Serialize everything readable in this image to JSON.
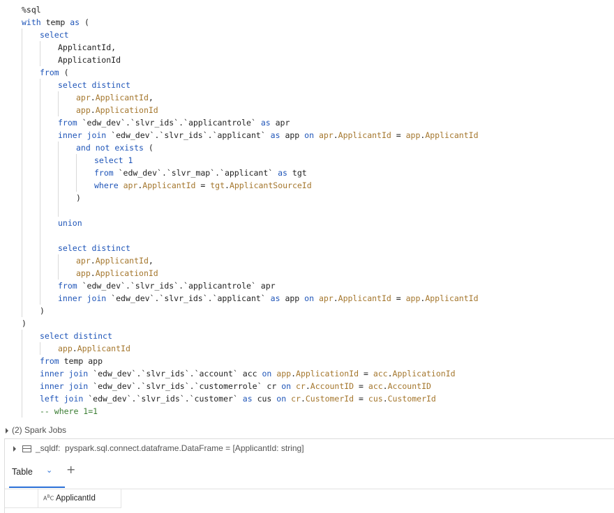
{
  "code_lines": [
    {
      "indent": 0,
      "tokens": [
        {
          "t": "%sql",
          "c": ""
        }
      ]
    },
    {
      "indent": 0,
      "tokens": [
        {
          "t": "with",
          "c": "kw"
        },
        {
          "t": " temp ",
          "c": ""
        },
        {
          "t": "as",
          "c": "kw"
        },
        {
          "t": " (",
          "c": ""
        }
      ]
    },
    {
      "indent": 1,
      "tokens": [
        {
          "t": "select",
          "c": "kw"
        }
      ]
    },
    {
      "indent": 2,
      "tokens": [
        {
          "t": "ApplicantId,",
          "c": ""
        }
      ]
    },
    {
      "indent": 2,
      "tokens": [
        {
          "t": "ApplicationId",
          "c": ""
        }
      ]
    },
    {
      "indent": 1,
      "tokens": [
        {
          "t": "from",
          "c": "kw"
        },
        {
          "t": " (",
          "c": ""
        }
      ]
    },
    {
      "indent": 2,
      "tokens": [
        {
          "t": "select",
          "c": "kw"
        },
        {
          "t": " ",
          "c": ""
        },
        {
          "t": "distinct",
          "c": "kw"
        }
      ]
    },
    {
      "indent": 3,
      "tokens": [
        {
          "t": "apr",
          "c": "al"
        },
        {
          "t": ".",
          "c": ""
        },
        {
          "t": "ApplicantId",
          "c": "al"
        },
        {
          "t": ",",
          "c": ""
        }
      ]
    },
    {
      "indent": 3,
      "tokens": [
        {
          "t": "app",
          "c": "al"
        },
        {
          "t": ".",
          "c": ""
        },
        {
          "t": "ApplicationId",
          "c": "al"
        }
      ]
    },
    {
      "indent": 2,
      "tokens": [
        {
          "t": "from",
          "c": "kw"
        },
        {
          "t": " `edw_dev`.`slvr_ids`.`applicantrole` ",
          "c": ""
        },
        {
          "t": "as",
          "c": "kw"
        },
        {
          "t": " apr",
          "c": ""
        }
      ]
    },
    {
      "indent": 2,
      "tokens": [
        {
          "t": "inner join",
          "c": "kw"
        },
        {
          "t": " `edw_dev`.`slvr_ids`.`applicant` ",
          "c": ""
        },
        {
          "t": "as",
          "c": "kw"
        },
        {
          "t": " app ",
          "c": ""
        },
        {
          "t": "on",
          "c": "kw"
        },
        {
          "t": " ",
          "c": ""
        },
        {
          "t": "apr",
          "c": "al"
        },
        {
          "t": ".",
          "c": ""
        },
        {
          "t": "ApplicantId",
          "c": "al"
        },
        {
          "t": " = ",
          "c": ""
        },
        {
          "t": "app",
          "c": "al"
        },
        {
          "t": ".",
          "c": ""
        },
        {
          "t": "ApplicantId",
          "c": "al"
        }
      ]
    },
    {
      "indent": 3,
      "tokens": [
        {
          "t": "and not exists",
          "c": "kw"
        },
        {
          "t": " (",
          "c": ""
        }
      ]
    },
    {
      "indent": 4,
      "tokens": [
        {
          "t": "select",
          "c": "kw"
        },
        {
          "t": " ",
          "c": ""
        },
        {
          "t": "1",
          "c": "kw"
        }
      ]
    },
    {
      "indent": 4,
      "tokens": [
        {
          "t": "from",
          "c": "kw"
        },
        {
          "t": " `edw_dev`.`slvr_map`.`applicant` ",
          "c": ""
        },
        {
          "t": "as",
          "c": "kw"
        },
        {
          "t": " tgt",
          "c": ""
        }
      ]
    },
    {
      "indent": 4,
      "tokens": [
        {
          "t": "where",
          "c": "kw"
        },
        {
          "t": " ",
          "c": ""
        },
        {
          "t": "apr",
          "c": "al"
        },
        {
          "t": ".",
          "c": ""
        },
        {
          "t": "ApplicantId",
          "c": "al"
        },
        {
          "t": " = ",
          "c": ""
        },
        {
          "t": "tgt",
          "c": "al"
        },
        {
          "t": ".",
          "c": ""
        },
        {
          "t": "ApplicantSourceId",
          "c": "al"
        }
      ]
    },
    {
      "indent": 3,
      "tokens": [
        {
          "t": ")",
          "c": ""
        }
      ]
    },
    {
      "indent": 3,
      "tokens": []
    },
    {
      "indent": 2,
      "tokens": [
        {
          "t": "union",
          "c": "kw"
        }
      ]
    },
    {
      "indent": 2,
      "tokens": []
    },
    {
      "indent": 2,
      "tokens": [
        {
          "t": "select",
          "c": "kw"
        },
        {
          "t": " ",
          "c": ""
        },
        {
          "t": "distinct",
          "c": "kw"
        }
      ]
    },
    {
      "indent": 3,
      "tokens": [
        {
          "t": "apr",
          "c": "al"
        },
        {
          "t": ".",
          "c": ""
        },
        {
          "t": "ApplicantId",
          "c": "al"
        },
        {
          "t": ",",
          "c": ""
        }
      ]
    },
    {
      "indent": 3,
      "tokens": [
        {
          "t": "app",
          "c": "al"
        },
        {
          "t": ".",
          "c": ""
        },
        {
          "t": "ApplicationId",
          "c": "al"
        }
      ]
    },
    {
      "indent": 2,
      "tokens": [
        {
          "t": "from",
          "c": "kw"
        },
        {
          "t": " `edw_dev`.`slvr_ids`.`applicantrole` apr",
          "c": ""
        }
      ]
    },
    {
      "indent": 2,
      "tokens": [
        {
          "t": "inner join",
          "c": "kw"
        },
        {
          "t": " `edw_dev`.`slvr_ids`.`applicant` ",
          "c": ""
        },
        {
          "t": "as",
          "c": "kw"
        },
        {
          "t": " app ",
          "c": ""
        },
        {
          "t": "on",
          "c": "kw"
        },
        {
          "t": " ",
          "c": ""
        },
        {
          "t": "apr",
          "c": "al"
        },
        {
          "t": ".",
          "c": ""
        },
        {
          "t": "ApplicantId",
          "c": "al"
        },
        {
          "t": " = ",
          "c": ""
        },
        {
          "t": "app",
          "c": "al"
        },
        {
          "t": ".",
          "c": ""
        },
        {
          "t": "ApplicantId",
          "c": "al"
        }
      ]
    },
    {
      "indent": 1,
      "tokens": [
        {
          "t": ")",
          "c": ""
        }
      ]
    },
    {
      "indent": 0,
      "tokens": [
        {
          "t": ")",
          "c": ""
        }
      ]
    },
    {
      "indent": 1,
      "tokens": [
        {
          "t": "select",
          "c": "kw"
        },
        {
          "t": " ",
          "c": ""
        },
        {
          "t": "distinct",
          "c": "kw"
        }
      ]
    },
    {
      "indent": 2,
      "tokens": [
        {
          "t": "app",
          "c": "al"
        },
        {
          "t": ".",
          "c": ""
        },
        {
          "t": "ApplicantId",
          "c": "al"
        }
      ]
    },
    {
      "indent": 1,
      "tokens": [
        {
          "t": "from",
          "c": "kw"
        },
        {
          "t": " temp app",
          "c": ""
        }
      ]
    },
    {
      "indent": 1,
      "tokens": [
        {
          "t": "inner join",
          "c": "kw"
        },
        {
          "t": " `edw_dev`.`slvr_ids`.`account` acc ",
          "c": ""
        },
        {
          "t": "on",
          "c": "kw"
        },
        {
          "t": " ",
          "c": ""
        },
        {
          "t": "app",
          "c": "al"
        },
        {
          "t": ".",
          "c": ""
        },
        {
          "t": "ApplicationId",
          "c": "al"
        },
        {
          "t": " = ",
          "c": ""
        },
        {
          "t": "acc",
          "c": "al"
        },
        {
          "t": ".",
          "c": ""
        },
        {
          "t": "ApplicationId",
          "c": "al"
        }
      ]
    },
    {
      "indent": 1,
      "tokens": [
        {
          "t": "inner join",
          "c": "kw"
        },
        {
          "t": " `edw_dev`.`slvr_ids`.`customerrole` cr ",
          "c": ""
        },
        {
          "t": "on",
          "c": "kw"
        },
        {
          "t": " ",
          "c": ""
        },
        {
          "t": "cr",
          "c": "al"
        },
        {
          "t": ".",
          "c": ""
        },
        {
          "t": "AccountID",
          "c": "al"
        },
        {
          "t": " = ",
          "c": ""
        },
        {
          "t": "acc",
          "c": "al"
        },
        {
          "t": ".",
          "c": ""
        },
        {
          "t": "AccountID",
          "c": "al"
        }
      ]
    },
    {
      "indent": 1,
      "tokens": [
        {
          "t": "left join",
          "c": "kw"
        },
        {
          "t": " `edw_dev`.`slvr_ids`.`customer` ",
          "c": ""
        },
        {
          "t": "as",
          "c": "kw"
        },
        {
          "t": " cus ",
          "c": ""
        },
        {
          "t": "on",
          "c": "kw"
        },
        {
          "t": " ",
          "c": ""
        },
        {
          "t": "cr",
          "c": "al"
        },
        {
          "t": ".",
          "c": ""
        },
        {
          "t": "CustomerId",
          "c": "al"
        },
        {
          "t": " = ",
          "c": ""
        },
        {
          "t": "cus",
          "c": "al"
        },
        {
          "t": ".",
          "c": ""
        },
        {
          "t": "CustomerId",
          "c": "al"
        }
      ]
    },
    {
      "indent": 1,
      "tokens": [
        {
          "t": "-- where 1=1",
          "c": "cm"
        }
      ]
    }
  ],
  "spark_jobs": {
    "label": "(2) Spark Jobs"
  },
  "dataframe": {
    "name": "_sqldf:",
    "type": "pyspark.sql.connect.dataframe.DataFrame = [ApplicantId: string]"
  },
  "tabs": [
    {
      "label": "Table",
      "active": true
    }
  ],
  "add_tab_symbol": "+",
  "caret_symbol": "⌄",
  "table": {
    "type_icon": "ABC",
    "columns": [
      "ApplicantId"
    ]
  },
  "colors": {
    "keyword": "#1f55b8",
    "alias": "#a4762c",
    "comment": "#3b7d33",
    "accent": "#2a6fd6"
  }
}
